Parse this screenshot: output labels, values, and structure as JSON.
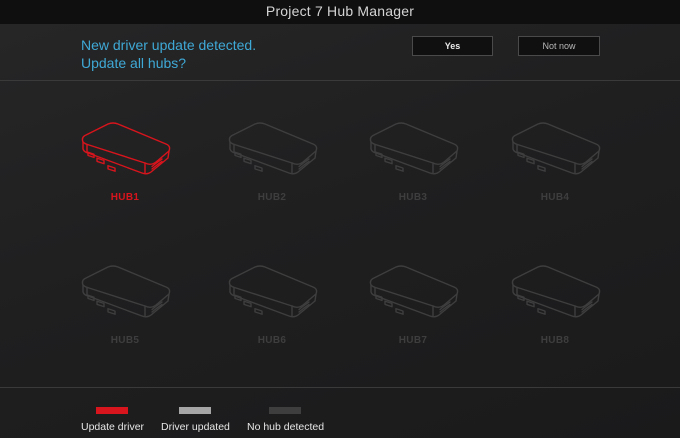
{
  "window": {
    "title": "Project 7 Hub Manager"
  },
  "prompt": {
    "line1": "New driver update detected.",
    "line2": "Update all hubs?",
    "yes_label": "Yes",
    "no_label": "Not now"
  },
  "colors": {
    "prompt_text": "#3fa9d6",
    "update_driver": "#d8141c",
    "driver_updated": "#a6a6a6",
    "no_hub_detected": "#3e3e3f"
  },
  "hubs": [
    {
      "label": "HUB1",
      "status": "update-driver"
    },
    {
      "label": "HUB2",
      "status": "no-hub-detected"
    },
    {
      "label": "HUB3",
      "status": "no-hub-detected"
    },
    {
      "label": "HUB4",
      "status": "no-hub-detected"
    },
    {
      "label": "HUB5",
      "status": "no-hub-detected"
    },
    {
      "label": "HUB6",
      "status": "no-hub-detected"
    },
    {
      "label": "HUB7",
      "status": "no-hub-detected"
    },
    {
      "label": "HUB8",
      "status": "no-hub-detected"
    }
  ],
  "legend": [
    {
      "label": "Update driver",
      "status": "update-driver"
    },
    {
      "label": "Driver updated",
      "status": "driver-updated"
    },
    {
      "label": "No hub detected",
      "status": "no-hub-detected"
    }
  ]
}
